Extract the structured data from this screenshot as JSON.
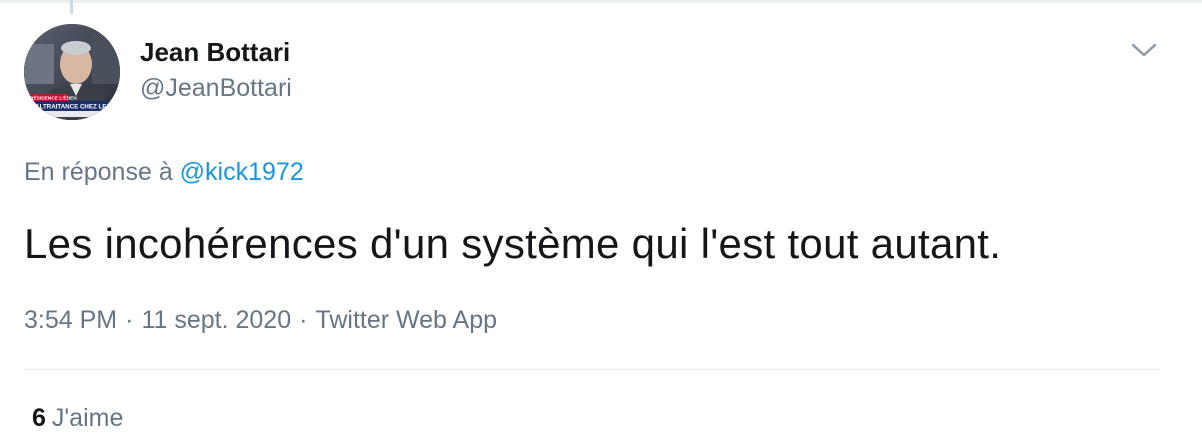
{
  "tweet": {
    "author": {
      "display_name": "Jean Bottari",
      "handle": "@JeanBottari",
      "avatar_caption_top": "RÉSIDENCE L'ÉDEN",
      "avatar_caption_main": "MALTRAITANCE CHEZ LES"
    },
    "reply": {
      "prefix": "En réponse à",
      "mention": "@kick1972"
    },
    "text": "Les incohérences d'un système qui l'est tout autant.",
    "meta": {
      "time": "3:54 PM",
      "separator_1": "·",
      "date": "11 sept. 2020",
      "separator_2": "·",
      "source": "Twitter Web App"
    },
    "stats": {
      "likes_count": "6",
      "likes_label": "J'aime"
    }
  },
  "icons": {
    "menu": "chevron-down-icon"
  },
  "colors": {
    "text_primary": "#14171a",
    "text_secondary": "#657786",
    "link": "#1b95e0",
    "divider": "#e6ecf0"
  }
}
